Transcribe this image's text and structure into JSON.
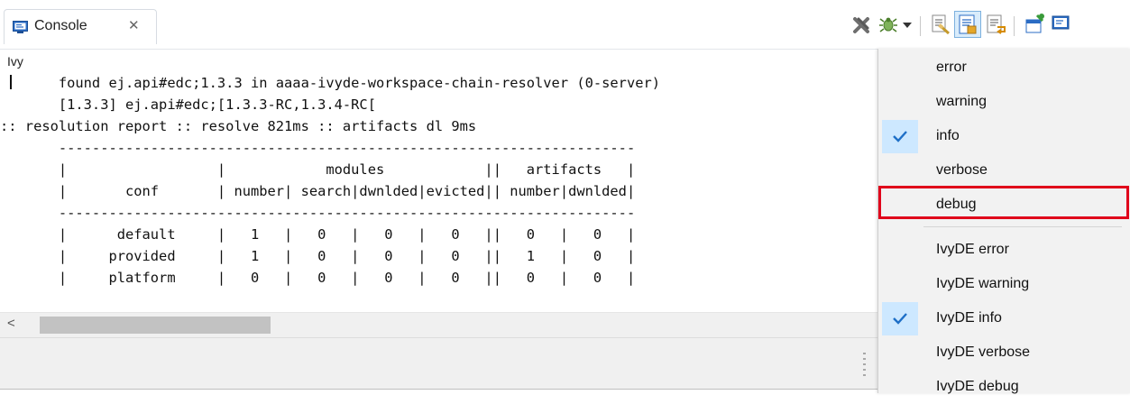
{
  "tab": {
    "label": "Console",
    "close_glyph": "✕",
    "icon": "console-icon"
  },
  "toolbar": {
    "icons": [
      "remove-all-terminated-icon",
      "debug-level-icon",
      "dropdown-arrow-icon",
      "clear-console-icon",
      "scroll-lock-icon",
      "word-wrap-icon",
      "pin-console-icon",
      "open-console-icon"
    ]
  },
  "console": {
    "name": "Ivy",
    "lines": [
      "       found ej.api#edc;1.3.3 in aaaa-ivyde-workspace-chain-resolver (0-server)",
      "       [1.3.3] ej.api#edc;[1.3.3-RC,1.3.4-RC[",
      ":: resolution report :: resolve 821ms :: artifacts dl 9ms",
      "       ---------------------------------------------------------------------",
      "       |                  |            modules            ||   artifacts   |",
      "       |       conf       | number| search|dwnlded|evicted|| number|dwnlded|",
      "       ---------------------------------------------------------------------",
      "       |      default     |   1   |   0   |   0   |   0   ||   0   |   0   |",
      "       |     provided     |   1   |   0   |   0   |   0   ||   1   |   0   |",
      "       |     platform     |   0   |   0   |   0   |   0   ||   0   |   0   |"
    ]
  },
  "scrollbar": {
    "left_arrow": "<"
  },
  "menu": {
    "items": [
      {
        "label": "error",
        "checked": false
      },
      {
        "label": "warning",
        "checked": false
      },
      {
        "label": "info",
        "checked": true
      },
      {
        "label": "verbose",
        "checked": false
      },
      {
        "label": "debug",
        "checked": false,
        "highlighted": true
      },
      {
        "label": "IvyDE error",
        "checked": false
      },
      {
        "label": "IvyDE warning",
        "checked": false
      },
      {
        "label": "IvyDE info",
        "checked": true
      },
      {
        "label": "IvyDE verbose",
        "checked": false
      },
      {
        "label": "IvyDE debug",
        "checked": false
      }
    ]
  },
  "colors": {
    "highlight": "#e0001b",
    "check_bg": "#cde8ff",
    "check": "#1e6fc7"
  }
}
